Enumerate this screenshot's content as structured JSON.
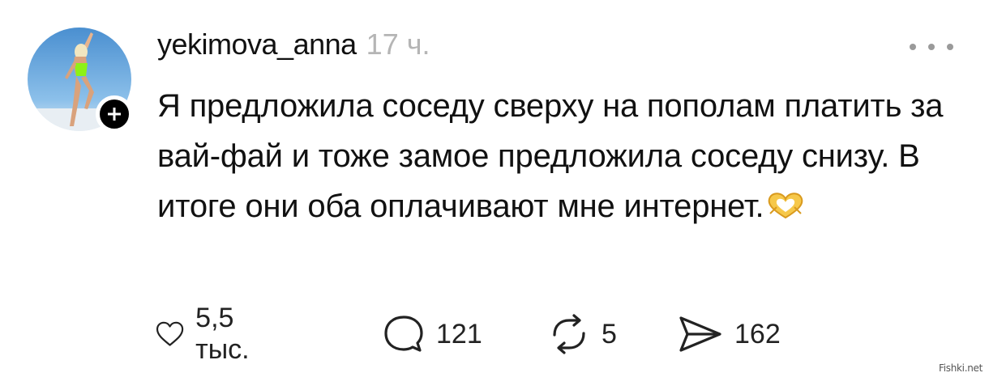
{
  "post": {
    "username": "yekimova_anna",
    "timestamp": "17 ч.",
    "text": "Я предложила соседу сверху на пополам платить за вай-фай и тоже замое предложила соседу снизу. В итоге они оба оплачивают мне интернет.",
    "emoji": "heart-hands-emoji"
  },
  "actions": {
    "likes": "5,5 тыс.",
    "comments": "121",
    "reposts": "5",
    "shares": "162"
  },
  "icons": {
    "like": "heart-icon",
    "comment": "comment-bubble-icon",
    "repost": "repost-icon",
    "share": "send-icon",
    "more": "more-options-icon",
    "follow": "plus-icon"
  },
  "watermark": "Fishki.net"
}
